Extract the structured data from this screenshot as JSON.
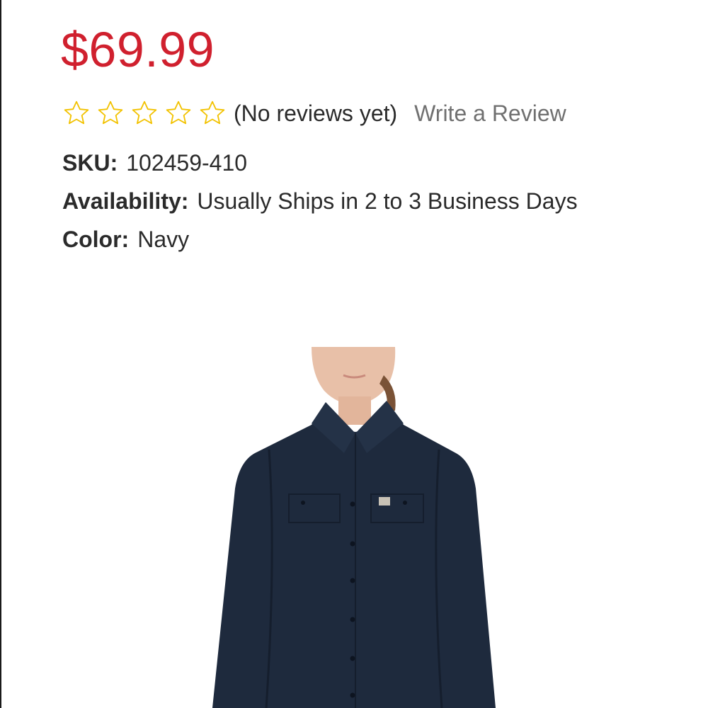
{
  "product": {
    "price": "$69.99",
    "rating": {
      "stars_filled": 0,
      "stars_total": 5,
      "reviews_text": "(No reviews yet)",
      "write_review_label": "Write a Review",
      "star_color": "#f2c200"
    },
    "sku": {
      "label": "SKU:",
      "value": "102459-410"
    },
    "availability": {
      "label": "Availability:",
      "value": "Usually Ships in 2 to 3 Business Days"
    },
    "color": {
      "label": "Color:",
      "value": "Navy"
    },
    "image_icon": "product-photo-navy-shirt"
  },
  "colors": {
    "price": "#d0202e",
    "text": "#2b2b2b",
    "link": "#707070",
    "shirt": "#1e2a3d"
  }
}
